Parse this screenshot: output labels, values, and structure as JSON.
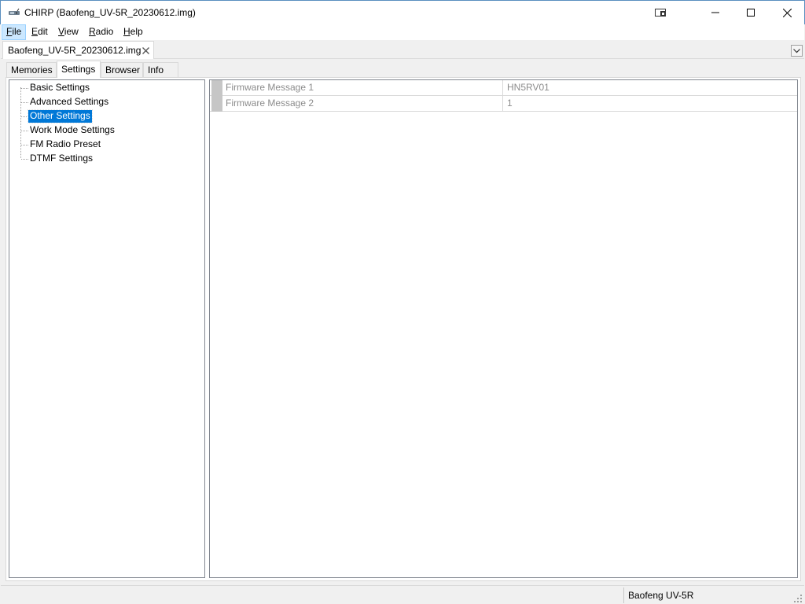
{
  "window": {
    "title": "CHIRP (Baofeng_UV-5R_20230612.img)",
    "app_icon": "radio-icon",
    "controls": [
      "picture-in-picture-icon",
      "minimize-icon",
      "maximize-icon",
      "close-icon"
    ]
  },
  "menu": {
    "items": [
      {
        "label": "File",
        "mnemonic": "F",
        "rest": "ile"
      },
      {
        "label": "Edit",
        "mnemonic": "E",
        "rest": "dit"
      },
      {
        "label": "View",
        "mnemonic": "V",
        "rest": "iew"
      },
      {
        "label": "Radio",
        "mnemonic": "R",
        "rest": "adio"
      },
      {
        "label": "Help",
        "mnemonic": "H",
        "rest": "elp"
      }
    ],
    "active": "File"
  },
  "document_tab": {
    "label": "Baofeng_UV-5R_20230612.img",
    "close_icon": "close-icon",
    "dropdown_icon": "chevron-down-icon"
  },
  "inner_tabs": [
    {
      "label": "Memories"
    },
    {
      "label": "Settings"
    },
    {
      "label": "Browser"
    },
    {
      "label": "Info"
    }
  ],
  "active_inner_tab": "Settings",
  "settings_tree": {
    "items": [
      {
        "label": "Basic Settings"
      },
      {
        "label": "Advanced Settings"
      },
      {
        "label": "Other Settings"
      },
      {
        "label": "Work Mode Settings"
      },
      {
        "label": "FM Radio Preset"
      },
      {
        "label": "DTMF Settings"
      }
    ],
    "selected": "Other Settings"
  },
  "settings_grid": {
    "rows": [
      {
        "name": "Firmware Message 1",
        "value": "HN5RV01"
      },
      {
        "name": "Firmware Message 2",
        "value": "1"
      }
    ]
  },
  "statusbar": {
    "radio_model": "Baofeng UV-5R"
  },
  "colors": {
    "selection": "#0078d7",
    "menu_active": "#cce8ff",
    "disabled_text": "#8c8c8c"
  }
}
